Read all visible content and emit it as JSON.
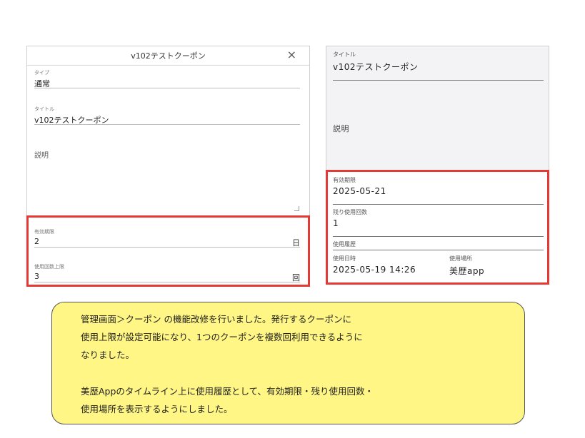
{
  "left_modal": {
    "title": "v102テストクーポン",
    "close": "×",
    "type_label": "タイプ",
    "type_value": "通常",
    "title_label": "タイトル",
    "title_value": "v102テストクーポン",
    "description_label": "説明",
    "expiry_label": "有効期限",
    "expiry_value": "2",
    "expiry_unit": "日",
    "limit_label": "使用回数上限",
    "limit_value": "3",
    "limit_unit": "回"
  },
  "right_view": {
    "title_label": "タイトル",
    "title_value": "v102テストクーポン",
    "description_label": "説明",
    "expiry_label": "有効期限",
    "expiry_value": "2025-05-21",
    "remaining_label": "残り使用回数",
    "remaining_value": "1",
    "history_label": "使用履歴",
    "history_date_label": "使用日時",
    "history_place_label": "使用場所",
    "history_date_value": "2025-05-19 14:26",
    "history_place_value": "美歴app"
  },
  "note": {
    "lines": [
      "管理画面＞クーポン の機能改修を行いました。発行するクーポンに",
      "使用上限が設定可能になり、1つのクーポンを複数回利用できるように",
      "なりました。",
      "美歴Appのタイムライン上に使用履歴として、有効期限・残り使用回数・",
      "使用場所を表示するようにしました。"
    ]
  },
  "colors": {
    "highlight": "#e53935",
    "note_bg": "#fff685",
    "panel_gray": "#f3f3f6"
  }
}
